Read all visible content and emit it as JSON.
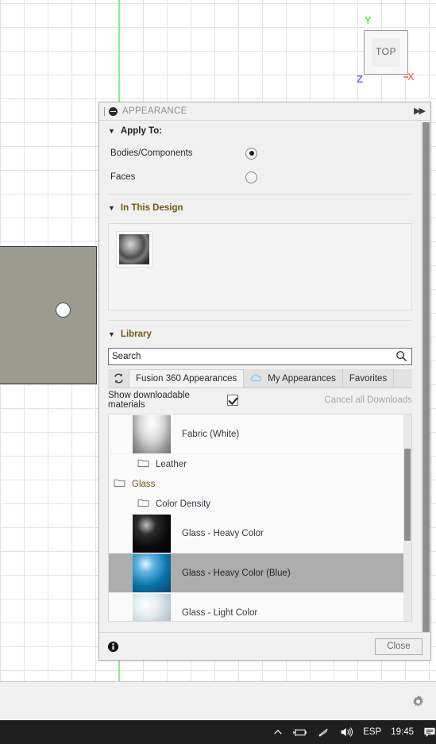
{
  "viewport": {
    "viewcube": {
      "face_label": "TOP",
      "axis_y": "Y",
      "axis_x": "X",
      "axis_z": "Z",
      "color_y": "#66dd66",
      "color_x": "#ff7b7b",
      "color_z": "#6f6fe8"
    },
    "grid_color": "#e3e3e3",
    "axis_line_color": "#8cec8c",
    "body_color": "#9b9b8f"
  },
  "dialog": {
    "title": "APPEARANCE",
    "collapse_icon": "minimize-icon",
    "expand_icon": "double-chevron-right-icon",
    "apply_to": {
      "header": "Apply To:",
      "options": [
        {
          "label": "Bodies/Components",
          "selected": true
        },
        {
          "label": "Faces",
          "selected": false
        }
      ]
    },
    "in_this_design": {
      "header": "In This Design",
      "swatch_name": "applied-appearance-swatch"
    },
    "library": {
      "header": "Library",
      "search": {
        "value": "Search",
        "placeholder": "Search",
        "icon": "search-icon"
      },
      "refresh_icon": "refresh-icon",
      "tabs": [
        {
          "label": "Fusion 360 Appearances",
          "active": true,
          "icon": ""
        },
        {
          "label": "My Appearances",
          "active": false,
          "icon": "cloud-icon"
        },
        {
          "label": "Favorites",
          "active": false,
          "icon": ""
        }
      ],
      "downloadable": {
        "label": "Show downloadable materials",
        "checked": true,
        "cancel_label": "Cancel all Downloads"
      },
      "items": [
        {
          "kind": "material",
          "name": "Fabric (White)",
          "thumb": "thumb-fabric",
          "selected": false,
          "indent": 0
        },
        {
          "kind": "folder",
          "name": "Leather",
          "selected": false,
          "indent": 1,
          "amber": false
        },
        {
          "kind": "folder",
          "name": "Glass",
          "selected": false,
          "indent": 0,
          "amber": true
        },
        {
          "kind": "folder",
          "name": "Color Density",
          "selected": false,
          "indent": 1,
          "amber": false
        },
        {
          "kind": "material",
          "name": "Glass - Heavy Color",
          "thumb": "thumb-black",
          "selected": false,
          "indent": 0
        },
        {
          "kind": "material",
          "name": "Glass - Heavy Color (Blue)",
          "thumb": "thumb-blue",
          "selected": true,
          "indent": 0
        },
        {
          "kind": "material",
          "name": "Glass - Light Color",
          "thumb": "thumb-light",
          "selected": false,
          "indent": 0
        }
      ]
    },
    "footer": {
      "info_icon": "info-icon",
      "close_label": "Close"
    }
  },
  "status_strip": {
    "gear_icon": "gear-icon"
  },
  "taskbar": {
    "chevron_icon": "chevron-up-icon",
    "battery_icon": "battery-charging-icon",
    "wifi_icon": "wifi-icon",
    "volume_icon": "volume-icon",
    "language": "ESP",
    "clock": "19:45",
    "notification_icon": "notification-icon"
  }
}
